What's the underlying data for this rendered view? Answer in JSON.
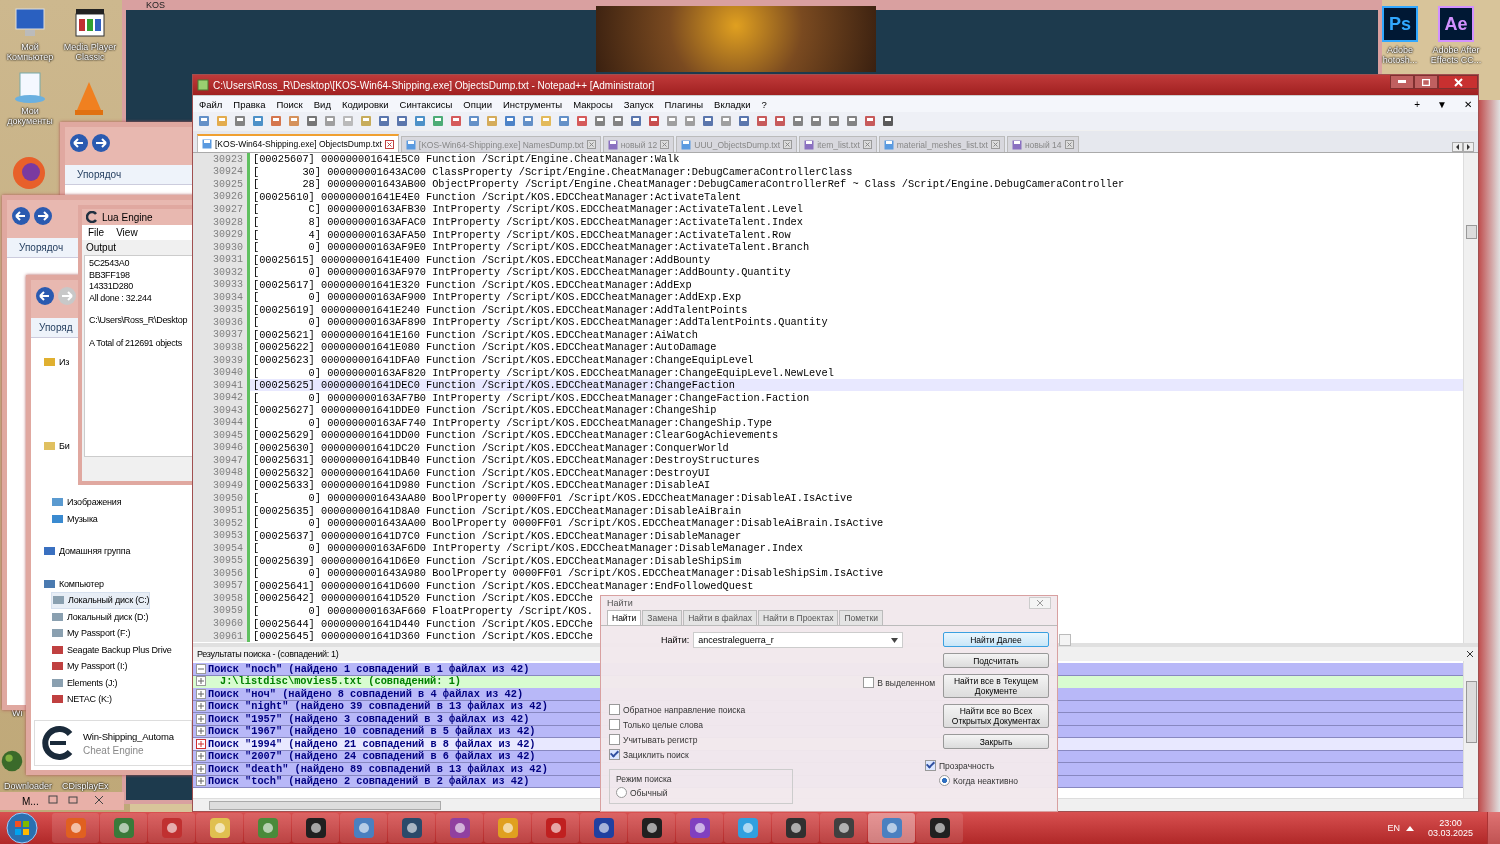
{
  "desktop_icons": [
    {
      "label": "Мой Компьютер",
      "kind": "computer"
    },
    {
      "label": "Media Player Classic",
      "kind": "player"
    },
    {
      "label": "Мои документы",
      "kind": "documents"
    }
  ],
  "desktop_icons_right": [
    {
      "glyph": "Ps",
      "label": "Adobe hotosh...",
      "color": "#31a8ff"
    },
    {
      "glyph": "Ae",
      "label": "Adobe After Effects CC...",
      "color": "#d291ff"
    }
  ],
  "desktop_labels_bottom": [
    "Downloader",
    "CDisplayEx"
  ],
  "desktop_label_cut": "Wi",
  "game_window": {
    "title": "KOS"
  },
  "explorer_windows": [
    {
      "toolbar": "Упорядоч"
    },
    {
      "toolbar": "Упорядоч"
    },
    {
      "toolbar": "Упоряд"
    }
  ],
  "explorer_nav": [
    {
      "label": "Из",
      "kind": "favorites",
      "selected": false
    },
    {
      "label": "Би",
      "kind": "library",
      "selected": false
    },
    {
      "label": "Изображения",
      "kind": "pictures",
      "selected": false
    },
    {
      "label": "Музыка",
      "kind": "music",
      "selected": false
    },
    {
      "label": "Домашняя группа",
      "kind": "homegroup",
      "selected": false
    },
    {
      "label": "Компьютер",
      "kind": "computer",
      "selected": false
    },
    {
      "label": "Локальный диск (C:)",
      "kind": "drive",
      "selected": true
    },
    {
      "label": "Локальный диск (D:)",
      "kind": "drive",
      "selected": false
    },
    {
      "label": "My Passport (F:)",
      "kind": "drive",
      "selected": false
    },
    {
      "label": "Seagate Backup Plus Drive",
      "kind": "usb",
      "selected": false
    },
    {
      "label": "My Passport (I:)",
      "kind": "usb",
      "selected": false
    },
    {
      "label": "Elements (J:)",
      "kind": "drive",
      "selected": false
    },
    {
      "label": "NETAC (K:)",
      "kind": "usb",
      "selected": false
    }
  ],
  "lua_engine": {
    "title": "Lua Engine",
    "menu": [
      "File",
      "View"
    ],
    "output_label": "Output",
    "blocks": [
      [
        "5C2543A0",
        "BB3FF198",
        "14331D280",
        "All done : 32.244"
      ],
      [
        "C:\\Users\\Ross_R\\Desktop"
      ],
      [
        "A Total of 212691 objects"
      ]
    ]
  },
  "cheat_engine_popup": {
    "title": "Win-Shipping_Automa",
    "subtitle": "Cheat Engine"
  },
  "minimized_window": {
    "label": "M..."
  },
  "notepad": {
    "title": "C:\\Users\\Ross_R\\Desktop\\[KOS-Win64-Shipping.exe] ObjectsDump.txt - Notepad++ [Administrator]",
    "menu": [
      "Файл",
      "Правка",
      "Поиск",
      "Вид",
      "Кодировки",
      "Синтаксисы",
      "Опции",
      "Инструменты",
      "Макросы",
      "Запуск",
      "Плагины",
      "Вкладки",
      "?"
    ],
    "menu_controls": [
      "+",
      "▼",
      "✕"
    ],
    "tabs": [
      {
        "label": "[KOS-Win64-Shipping.exe] ObjectsDump.txt",
        "selected": true,
        "kind": "file"
      },
      {
        "label": "[KOS-Win64-Shipping.exe] NamesDump.txt",
        "selected": false,
        "kind": "file"
      },
      {
        "label": "новый 12",
        "selected": false,
        "kind": "new"
      },
      {
        "label": "UUU_ObjectsDump.txt",
        "selected": false,
        "kind": "file"
      },
      {
        "label": "item_list.txt",
        "selected": false,
        "kind": "new"
      },
      {
        "label": "material_meshes_list.txt",
        "selected": false,
        "kind": "file"
      },
      {
        "label": "новый 14",
        "selected": false,
        "kind": "new"
      }
    ],
    "lines": [
      {
        "num": "30923",
        "text": "[00025607] 000000001641E5C0 Function /Script/Engine.CheatManager:Walk",
        "current": false
      },
      {
        "num": "30924",
        "text": "[       30] 000000001643AC00 ClassProperty /Script/Engine.CheatManager:DebugCameraControllerClass",
        "current": false
      },
      {
        "num": "30925",
        "text": "[       28] 000000001643AB00 ObjectProperty /Script/Engine.CheatManager:DebugCameraControllerRef ~ Class /Script/Engine.DebugCameraController",
        "current": false
      },
      {
        "num": "30926",
        "text": "[00025610] 000000001641E4E0 Function /Script/KOS.EDCCheatManager:ActivateTalent",
        "current": false
      },
      {
        "num": "30927",
        "text": "[        C] 00000000163AFB30 IntProperty /Script/KOS.EDCCheatManager:ActivateTalent.Level",
        "current": false
      },
      {
        "num": "30928",
        "text": "[        8] 00000000163AFAC0 IntProperty /Script/KOS.EDCCheatManager:ActivateTalent.Index",
        "current": false
      },
      {
        "num": "30929",
        "text": "[        4] 00000000163AFA50 IntProperty /Script/KOS.EDCCheatManager:ActivateTalent.Row",
        "current": false
      },
      {
        "num": "30930",
        "text": "[        0] 00000000163AF9E0 IntProperty /Script/KOS.EDCCheatManager:ActivateTalent.Branch",
        "current": false
      },
      {
        "num": "30931",
        "text": "[00025615] 000000001641E400 Function /Script/KOS.EDCCheatManager:AddBounty",
        "current": false
      },
      {
        "num": "30932",
        "text": "[        0] 00000000163AF970 IntProperty /Script/KOS.EDCCheatManager:AddBounty.Quantity",
        "current": false
      },
      {
        "num": "30933",
        "text": "[00025617] 000000001641E320 Function /Script/KOS.EDCCheatManager:AddExp",
        "current": false
      },
      {
        "num": "30934",
        "text": "[        0] 00000000163AF900 IntProperty /Script/KOS.EDCCheatManager:AddExp.Exp",
        "current": false
      },
      {
        "num": "30935",
        "text": "[00025619] 000000001641E240 Function /Script/KOS.EDCCheatManager:AddTalentPoints",
        "current": false
      },
      {
        "num": "30936",
        "text": "[        0] 00000000163AF890 IntProperty /Script/KOS.EDCCheatManager:AddTalentPoints.Quantity",
        "current": false
      },
      {
        "num": "30937",
        "text": "[00025621] 000000001641E160 Function /Script/KOS.EDCCheatManager:AiWatch",
        "current": false
      },
      {
        "num": "30938",
        "text": "[00025622] 000000001641E080 Function /Script/KOS.EDCCheatManager:AutoDamage",
        "current": false
      },
      {
        "num": "30939",
        "text": "[00025623] 000000001641DFA0 Function /Script/KOS.EDCCheatManager:ChangeEquipLevel",
        "current": false
      },
      {
        "num": "30940",
        "text": "[        0] 00000000163AF820 IntProperty /Script/KOS.EDCCheatManager:ChangeEquipLevel.NewLevel",
        "current": false
      },
      {
        "num": "30941",
        "text": "[00025625] 000000001641DEC0 Function /Script/KOS.EDCCheatManager:ChangeFaction",
        "current": true
      },
      {
        "num": "30942",
        "text": "[        0] 00000000163AF7B0 IntProperty /Script/KOS.EDCCheatManager:ChangeFaction.Faction",
        "current": false
      },
      {
        "num": "30943",
        "text": "[00025627] 000000001641DDE0 Function /Script/KOS.EDCCheatManager:ChangeShip",
        "current": false
      },
      {
        "num": "30944",
        "text": "[        0] 00000000163AF740 IntProperty /Script/KOS.EDCCheatManager:ChangeShip.Type",
        "current": false
      },
      {
        "num": "30945",
        "text": "[00025629] 000000001641DD00 Function /Script/KOS.EDCCheatManager:ClearGogAchievements",
        "current": false
      },
      {
        "num": "30946",
        "text": "[00025630] 000000001641DC20 Function /Script/KOS.EDCCheatManager:ConquerWorld",
        "current": false
      },
      {
        "num": "30947",
        "text": "[00025631] 000000001641DB40 Function /Script/KOS.EDCCheatManager:DestroyStructures",
        "current": false
      },
      {
        "num": "30948",
        "text": "[00025632] 000000001641DA60 Function /Script/KOS.EDCCheatManager:DestroyUI",
        "current": false
      },
      {
        "num": "30949",
        "text": "[00025633] 000000001641D980 Function /Script/KOS.EDCCheatManager:DisableAI",
        "current": false
      },
      {
        "num": "30950",
        "text": "[        0] 000000001643AA80 BoolProperty 0000FF01 /Script/KOS.EDCCheatManager:DisableAI.IsActive",
        "current": false
      },
      {
        "num": "30951",
        "text": "[00025635] 000000001641D8A0 Function /Script/KOS.EDCCheatManager:DisableAiBrain",
        "current": false
      },
      {
        "num": "30952",
        "text": "[        0] 000000001643AA00 BoolProperty 0000FF01 /Script/KOS.EDCCheatManager:DisableAiBrain.IsActive",
        "current": false
      },
      {
        "num": "30953",
        "text": "[00025637] 000000001641D7C0 Function /Script/KOS.EDCCheatManager:DisableManager",
        "current": false
      },
      {
        "num": "30954",
        "text": "[        0] 00000000163AF6D0 IntProperty /Script/KOS.EDCCheatManager:DisableManager.Index",
        "current": false
      },
      {
        "num": "30955",
        "text": "[00025639] 000000001641D6E0 Function /Script/KOS.EDCCheatManager:DisableShipSim",
        "current": false
      },
      {
        "num": "30956",
        "text": "[        0] 000000001643A980 BoolProperty 0000FF01 /Script/KOS.EDCCheatManager:DisableShipSim.IsActive",
        "current": false
      },
      {
        "num": "30957",
        "text": "[00025641] 000000001641D600 Function /Script/KOS.EDCCheatManager:EndFollowedQuest",
        "current": false
      },
      {
        "num": "30958",
        "text": "[00025642] 000000001641D520 Function /Script/KOS.EDCChe",
        "current": false
      },
      {
        "num": "30959",
        "text": "[        0] 00000000163AF660 FloatProperty /Script/KOS.",
        "current": false
      },
      {
        "num": "30960",
        "text": "[00025644] 000000001641D440 Function /Script/KOS.EDCChe",
        "current": false
      },
      {
        "num": "30961",
        "text": "[00025645] 000000001641D360 Function /Script/KOS.EDCChe",
        "current": false
      }
    ],
    "search_results": {
      "header": "Результаты поиска - (совпадений: 1)",
      "rows": [
        {
          "kind": "search",
          "text": "Поиск \"noch\" (найдено 1 совпадений в 1 файлах из 42)",
          "expanded": true,
          "selected": false
        },
        {
          "kind": "file",
          "text": "J:\\listdisc\\movies5.txt (совпадений: 1)",
          "expanded": false,
          "selected": false
        },
        {
          "kind": "search",
          "text": "Поиск \"ноч\" (найдено 8 совпадений в 4 файлах из 42)",
          "expanded": false,
          "selected": false
        },
        {
          "kind": "search",
          "text": "Поиск \"night\" (найдено 39 совпадений в 13 файлах из 42)",
          "expanded": false,
          "selected": false
        },
        {
          "kind": "search",
          "text": "Поиск \"1957\" (найдено 3 совпадений в 3 файлах из 42)",
          "expanded": false,
          "selected": false
        },
        {
          "kind": "search",
          "text": "Поиск \"1967\" (найдено 10 совпадений в 5 файлах из 42)",
          "expanded": false,
          "selected": false
        },
        {
          "kind": "search",
          "text": "Поиск \"1994\" (найдено 21 совпадений в 8 файлах из 42)",
          "expanded": false,
          "selected": true
        },
        {
          "kind": "search",
          "text": "Поиск \"2007\" (найдено 24 совпадений в 6 файлах из 42)",
          "expanded": false,
          "selected": false
        },
        {
          "kind": "search",
          "text": "Поиск \"death\" (найдено 89 совпадений в 13 файлах из 42)",
          "expanded": false,
          "selected": false
        },
        {
          "kind": "search",
          "text": "Поиск \"toch\" (найдено 2 совпадений в 2 файлах из 42)",
          "expanded": false,
          "selected": false
        }
      ]
    }
  },
  "find_dialog": {
    "title": "Найти",
    "tabs": [
      {
        "label": "Найти",
        "selected": true
      },
      {
        "label": "Замена",
        "selected": false
      },
      {
        "label": "Найти в файлах",
        "selected": false
      },
      {
        "label": "Найти в Проектах",
        "selected": false
      },
      {
        "label": "Пометки",
        "selected": false
      }
    ],
    "find_label": "Найти:",
    "find_value": "ancestraleguerra_r",
    "buttons": [
      {
        "label": "Найти Далее",
        "kind": "default"
      },
      {
        "label": "Подсчитать",
        "kind": "normal"
      },
      {
        "label": "Найти все в Текущем Документе",
        "kind": "normal"
      },
      {
        "label": "Найти все во Всех Открытых Документах",
        "kind": "normal"
      },
      {
        "label": "Закрыть",
        "kind": "normal"
      }
    ],
    "in_selection": {
      "label": "В выделенном",
      "checked": false
    },
    "two_button_mode": {
      "checked": false
    },
    "options": [
      {
        "label": "Обратное направление поиска",
        "checked": false
      },
      {
        "label": "Только целые слова",
        "checked": false
      },
      {
        "label": "Учитывать регистр",
        "checked": false
      },
      {
        "label": "Зациклить поиск",
        "checked": true
      }
    ],
    "mode_label": "Режим поиска",
    "mode_options": [
      {
        "label": "Обычный",
        "selected": false
      }
    ],
    "transparency": {
      "label": "Прозрачность",
      "checked": true
    },
    "transparency_options": [
      {
        "label": "Когда неактивно",
        "selected": true
      }
    ]
  },
  "taskbar": {
    "language": "EN",
    "time": "23:00",
    "date": "03.03.2025"
  }
}
